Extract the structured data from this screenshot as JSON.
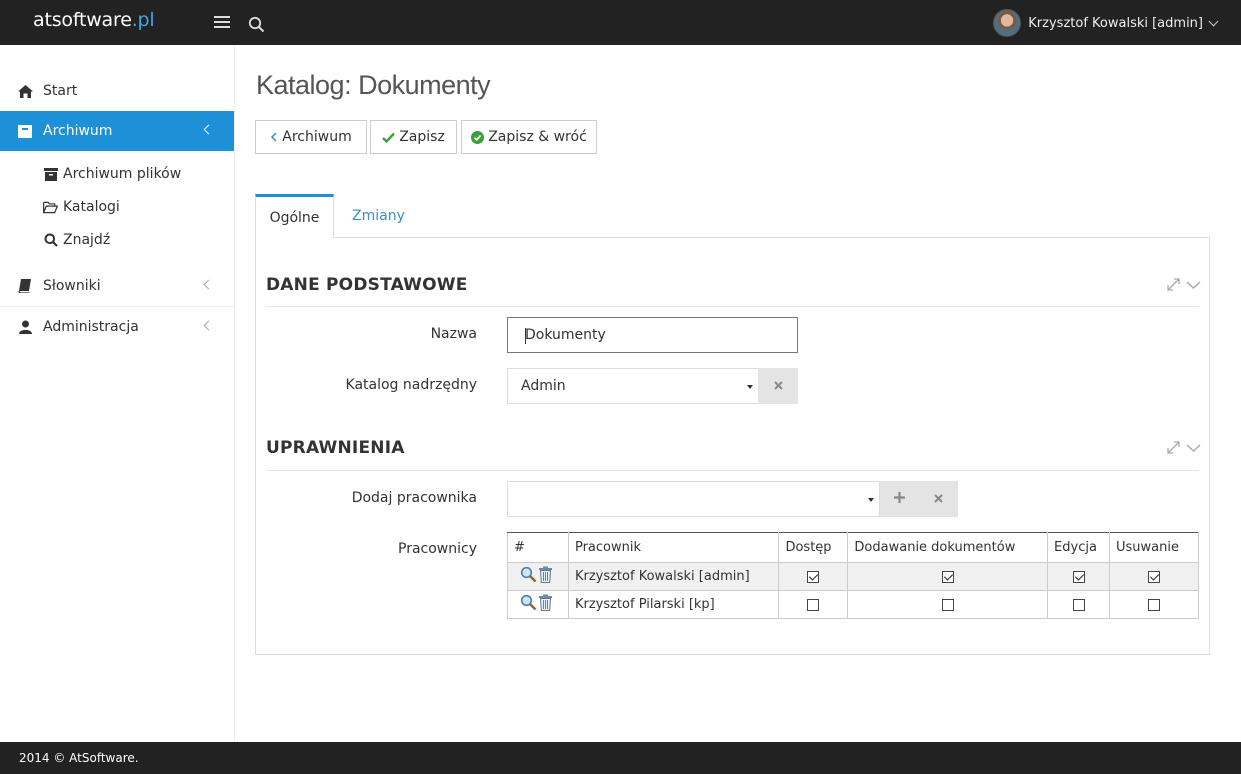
{
  "brand": {
    "name": "atsoftware",
    "tld": ".pl"
  },
  "user": {
    "name": "Krzysztof Kowalski [admin]"
  },
  "sidebar": {
    "items": [
      {
        "label": "Start",
        "icon": "home-icon"
      },
      {
        "label": "Archiwum",
        "icon": "archive-icon",
        "active": true
      },
      {
        "label": "Słowniki",
        "icon": "book-icon"
      },
      {
        "label": "Administracja",
        "icon": "user-icon"
      }
    ],
    "subitems": [
      {
        "label": "Archiwum plików",
        "icon": "archive-box-icon"
      },
      {
        "label": "Katalogi",
        "icon": "folder-open-icon"
      },
      {
        "label": "Znajdź",
        "icon": "search-icon"
      }
    ]
  },
  "page": {
    "title": "Katalog: Dokumenty"
  },
  "toolbar": {
    "back_label": "Archiwum",
    "save_label": "Zapisz",
    "save_return_label": "Zapisz & wróć"
  },
  "tabs": [
    {
      "label": "Ogólne"
    },
    {
      "label": "Zmiany"
    }
  ],
  "sections": {
    "basic": {
      "title": "DANE PODSTAWOWE",
      "name_label": "Nazwa",
      "name_value": "Dokumenty",
      "parent_label": "Katalog nadrzędny",
      "parent_value": "Admin"
    },
    "permissions": {
      "title": "UPRAWNIENIA",
      "add_label": "Dodaj pracownika",
      "add_value": "",
      "workers_label": "Pracownicy",
      "columns": [
        "#",
        "Pracownik",
        "Dostęp",
        "Dodawanie dokumentów",
        "Edycja",
        "Usuwanie"
      ],
      "rows": [
        {
          "name": "Krzysztof Kowalski [admin]",
          "access": true,
          "add_docs": true,
          "edit": true,
          "delete": true
        },
        {
          "name": "Krzysztof Pilarski [kp]",
          "access": false,
          "add_docs": false,
          "edit": false,
          "delete": false
        }
      ]
    }
  },
  "footer": {
    "text": "2014 © AtSoftware."
  },
  "colors": {
    "accent": "#1e90d8",
    "topbar": "#222222",
    "tab_link": "#3a8dc8"
  }
}
